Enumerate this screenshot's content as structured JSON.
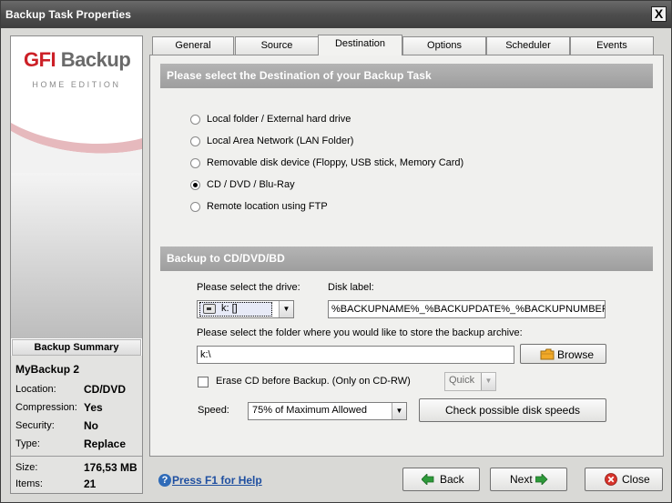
{
  "window": {
    "title": "Backup Task Properties",
    "close_glyph": "X"
  },
  "logo": {
    "brand_a": "GFI",
    "brand_b": " Backup",
    "subtitle": "HOME EDITION"
  },
  "summary": {
    "header": "Backup Summary",
    "name": "MyBackup 2",
    "rows": [
      {
        "label": "Location:",
        "value": "CD/DVD"
      },
      {
        "label": "Compression:",
        "value": "Yes"
      },
      {
        "label": "Security:",
        "value": "No"
      },
      {
        "label": "Type:",
        "value": "Replace"
      }
    ],
    "size_label": "Size:",
    "size_value": "176,53 MB",
    "items_label": "Items:",
    "items_value": "21"
  },
  "tabs": [
    {
      "label": "General",
      "active": false
    },
    {
      "label": "Source",
      "active": false
    },
    {
      "label": "Destination",
      "active": true
    },
    {
      "label": "Options",
      "active": false
    },
    {
      "label": "Scheduler",
      "active": false
    },
    {
      "label": "Events",
      "active": false
    }
  ],
  "destination": {
    "header": "Please select the Destination of your Backup Task",
    "options": [
      {
        "label": "Local folder / External hard drive",
        "checked": false
      },
      {
        "label": "Local Area Network (LAN Folder)",
        "checked": false
      },
      {
        "label": "Removable disk device (Floppy, USB stick, Memory Card)",
        "checked": false
      },
      {
        "label": "CD / DVD / Blu-Ray",
        "checked": true
      },
      {
        "label": "Remote location using FTP",
        "checked": false
      }
    ]
  },
  "cd": {
    "header": "Backup to CD/DVD/BD",
    "drive_label": "Please select the drive:",
    "drive_value": "k: []",
    "disk_label_label": "Disk label:",
    "disk_label_value": "%BACKUPNAME%_%BACKUPDATE%_%BACKUPNUMBER%",
    "folder_label": "Please select the folder where you would like to store the backup archive:",
    "folder_value": "k:\\",
    "browse_label": "Browse",
    "erase_label": "Erase CD before Backup. (Only on CD-RW)",
    "erase_checked": false,
    "erase_mode": "Quick",
    "speed_label": "Speed:",
    "speed_value": "75% of Maximum Allowed",
    "check_speeds_label": "Check possible disk speeds"
  },
  "footer": {
    "help_label": "Press F1 for Help",
    "back_label": "Back",
    "next_label": "Next",
    "close_label": "Close"
  },
  "colors": {
    "accent_red": "#cc2027",
    "header_gray": "#a8a8a8",
    "arrow_green": "#2e9a3a",
    "link_blue": "#1f4fa0"
  }
}
